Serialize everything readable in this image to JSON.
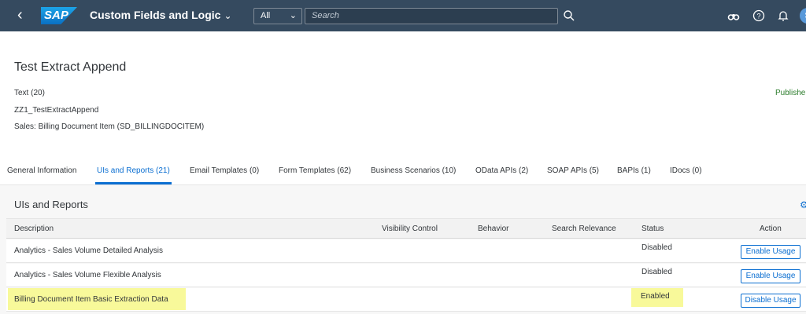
{
  "shell": {
    "app_title": "Custom Fields and Logic",
    "logo_text": "SAP",
    "scope": "All",
    "search_placeholder": "Search",
    "avatar_initial": "S"
  },
  "header": {
    "title": "Test Extract Append",
    "attributes": [
      "Text (20)",
      "ZZ1_TestExtractAppend",
      "Sales: Billing Document Item (SD_BILLINGDOCITEM)"
    ],
    "status": "Publishe"
  },
  "tabs": [
    {
      "label": "General Information",
      "active": false
    },
    {
      "label": "UIs and Reports (21)",
      "active": true
    },
    {
      "label": "Email Templates (0)",
      "active": false
    },
    {
      "label": "Form Templates (62)",
      "active": false
    },
    {
      "label": "Business Scenarios (10)",
      "active": false
    },
    {
      "label": "OData APIs (2)",
      "active": false
    },
    {
      "label": "SOAP APIs (5)",
      "active": false
    },
    {
      "label": "BAPIs (1)",
      "active": false
    },
    {
      "label": "IDocs (0)",
      "active": false
    }
  ],
  "section": {
    "title": "UIs and Reports",
    "columns": {
      "description": "Description",
      "visibility": "Visibility Control",
      "behavior": "Behavior",
      "search": "Search Relevance",
      "status": "Status",
      "action": "Action"
    },
    "rows": [
      {
        "description": "Analytics - Sales Volume Detailed Analysis",
        "status": "Disabled",
        "action": "Enable Usage",
        "highlighted": false
      },
      {
        "description": "Analytics - Sales Volume Flexible Analysis",
        "status": "Disabled",
        "action": "Enable Usage",
        "highlighted": false
      },
      {
        "description": "Billing Document Item Basic Extraction Data",
        "status": "Enabled",
        "action": "Disable Usage",
        "highlighted": true
      }
    ]
  },
  "colors": {
    "shell_bg": "#354a5f",
    "accent": "#0a6ed1",
    "highlight": "#f8f99a",
    "published": "#2b7c2b"
  },
  "icons": [
    "back-icon",
    "chevron-down-icon",
    "search-icon",
    "binoculars-icon",
    "help-icon",
    "notification-bell-icon",
    "settings-icon"
  ]
}
